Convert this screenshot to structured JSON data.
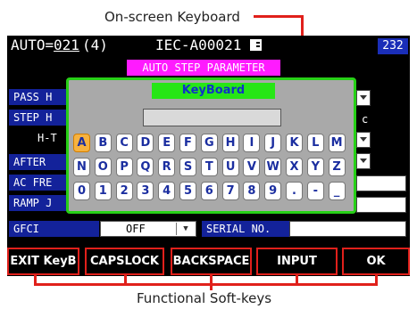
{
  "annotations": {
    "keyboard_callout": "On-screen Keyboard",
    "softkeys_callout": "Functional Soft-keys"
  },
  "top_bar": {
    "mode_label": "AUTO=",
    "step_number": "021",
    "step_count": "(4)",
    "file_name": "IEC-A00021",
    "file_icon": "file-icon",
    "badge": "232"
  },
  "parameter_panel": {
    "title": "AUTO STEP PARAMETER",
    "labels": [
      "PASS H",
      "STEP H",
      "H-T",
      "AFTER",
      "AC FRE",
      "RAMP J",
      "GFCI"
    ],
    "right_glyphs": [
      "c"
    ],
    "gfci_value": "OFF",
    "serial_label": "SERIAL NO."
  },
  "keyboard": {
    "title": "KeyBoard",
    "input_value": "",
    "rows": [
      [
        "A",
        "B",
        "C",
        "D",
        "E",
        "F",
        "G",
        "H",
        "I",
        "J",
        "K",
        "L",
        "M"
      ],
      [
        "N",
        "O",
        "P",
        "Q",
        "R",
        "S",
        "T",
        "U",
        "V",
        "W",
        "X",
        "Y",
        "Z"
      ],
      [
        "0",
        "1",
        "2",
        "3",
        "4",
        "5",
        "6",
        "7",
        "8",
        "9",
        ".",
        "-",
        "_"
      ]
    ],
    "selected_key": "A"
  },
  "softkeys": [
    "EXIT KeyB",
    "CAPSLOCK",
    "BACKSPACE",
    "INPUT",
    "OK"
  ],
  "colors": {
    "callout_line": "#e0201b",
    "keyboard_border": "#27d017",
    "title_bar": "#ff1bff",
    "label_bg": "#13229a",
    "selected_key": "#f7b23f"
  }
}
